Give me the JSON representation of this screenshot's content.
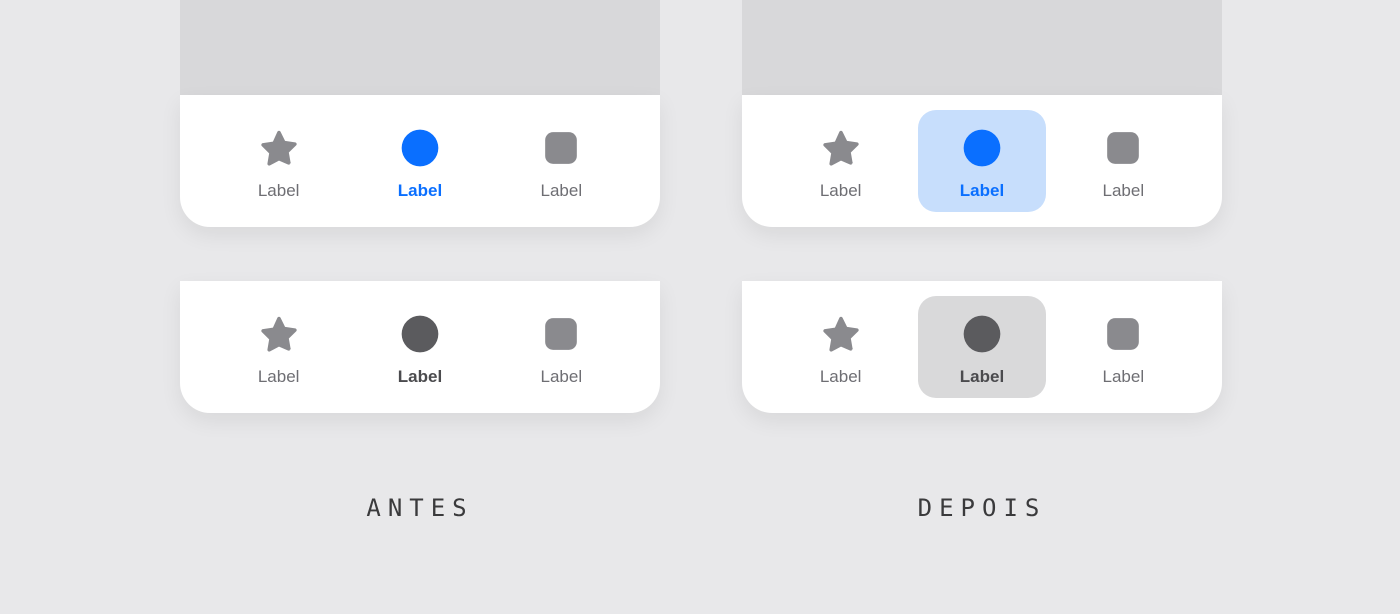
{
  "captions": {
    "before": "ANTES",
    "after": "DEPOIS"
  },
  "tabs": {
    "item1": "Label",
    "item2": "Label",
    "item3": "Label"
  },
  "colors": {
    "accent_blue": "#0A6FFF",
    "highlight_blue": "#C7DEFC",
    "highlight_gray": "#D9D9DA",
    "icon_gray": "#8A8A8E",
    "icon_dark": "#5B5B5E",
    "text_muted": "#6E6E73"
  }
}
